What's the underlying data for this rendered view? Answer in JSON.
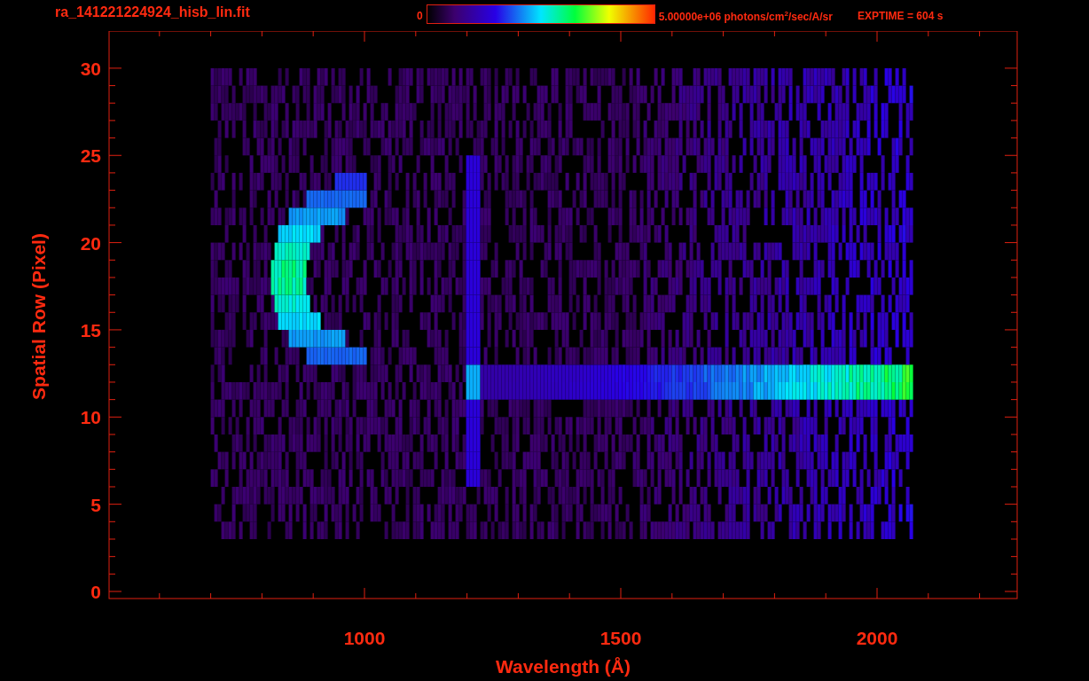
{
  "header": {
    "filename": "ra_141221224924_hisb_lin.fit",
    "colorbar_min": "0",
    "colorbar_max": "5.00000e+06 photons/cm$^{2}$/sec/A/sr",
    "exptime": "EXPTIME = 604 s"
  },
  "plot": {
    "xlabel": "Wavelength (Å)",
    "ylabel": "Spatial Row (Pixel)",
    "xtick_labels": [
      "1000",
      "1500",
      "2000"
    ],
    "ytick_labels": [
      "30",
      "25",
      "20",
      "15",
      "10",
      "5",
      "0"
    ]
  }
}
